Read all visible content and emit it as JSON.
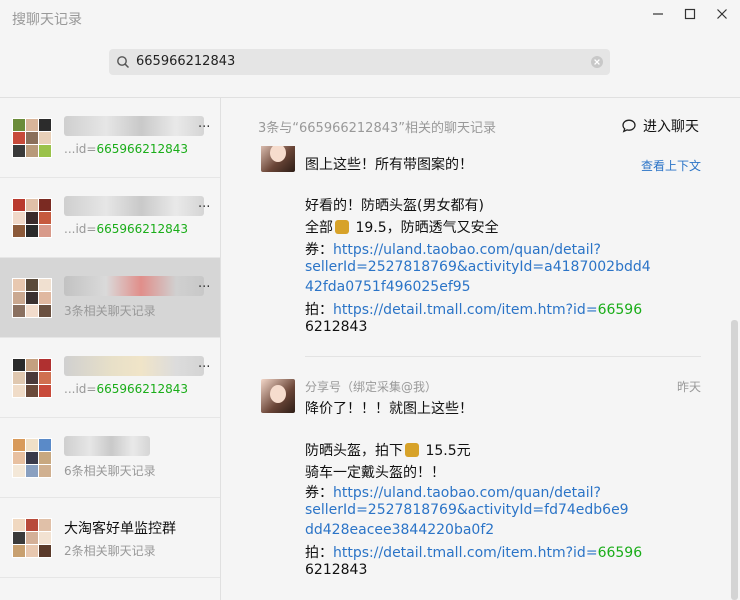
{
  "window": {
    "title": "搜聊天记录"
  },
  "search": {
    "query": "665966212843"
  },
  "sidebar": {
    "items": [
      {
        "name": "",
        "sub_prefix": "...id=",
        "sub_highlight": "665966212843",
        "sub_suffix": ""
      },
      {
        "name": "",
        "sub_prefix": "...id=",
        "sub_highlight": "665966212843",
        "sub_suffix": ""
      },
      {
        "name": "",
        "sub_prefix": "",
        "sub_highlight": "",
        "sub_suffix": "3条相关聊天记录",
        "selected": true
      },
      {
        "name": "",
        "sub_prefix": "...id=",
        "sub_highlight": "665966212843",
        "sub_suffix": ""
      },
      {
        "name": "",
        "sub_prefix": "",
        "sub_highlight": "",
        "sub_suffix": "6条相关聊天记录"
      },
      {
        "name": "大淘客好单监控群",
        "sub_prefix": "",
        "sub_highlight": "",
        "sub_suffix": "2条相关聊天记录"
      }
    ]
  },
  "panel": {
    "header": "3条与“665966212843”相关的聊天记录",
    "enter_chat_label": "进入聊天"
  },
  "messages": [
    {
      "context_link": "查看上下文",
      "lines": [
        {
          "text": "图上这些！所有带图案的！"
        },
        {
          "text": ""
        },
        {
          "text": "好看的！防晒头盔(男女都有)"
        },
        {
          "pre": "全部",
          "post": " 19.5，防晒透气又安全"
        },
        {
          "pre": "券：",
          "link": "https://uland.taobao.com/quan/detail?"
        },
        {
          "link": "sellerId=2527818769&activityId=a4187002bdd4"
        },
        {
          "link": "42fda0751f496025ef95"
        },
        {
          "pre": "拍：",
          "link": "https://detail.tmall.com/item.htm?id=",
          "hl": "66596"
        },
        {
          "hl": "6212843"
        }
      ]
    },
    {
      "sender": "分享号（绑定采集@我）",
      "time": "昨天",
      "lines": [
        {
          "text": "降价了！！！就图上这些！"
        },
        {
          "text": ""
        },
        {
          "pre": "防晒头盔，拍下",
          "post": " 15.5元"
        },
        {
          "text": "骑车一定戴头盔的！！"
        },
        {
          "pre": "券：",
          "link": "https://uland.taobao.com/quan/detail?"
        },
        {
          "link": "sellerId=2527818769&activityId=fd74edb6e9"
        },
        {
          "link": "dd428eacee3844220ba0f2"
        },
        {
          "pre": "拍：",
          "link": "https://detail.tmall.com/item.htm?id=",
          "hl": "66596"
        },
        {
          "hl": "6212843"
        }
      ]
    }
  ],
  "colors": {
    "highlight": "#1aad19",
    "link": "#2b74c7",
    "selected_row": "#d6d6d6"
  },
  "icons": {
    "search": "search-icon",
    "clear": "clear-icon",
    "chat": "chat-bubble-icon",
    "coin": "money-bag-icon"
  }
}
